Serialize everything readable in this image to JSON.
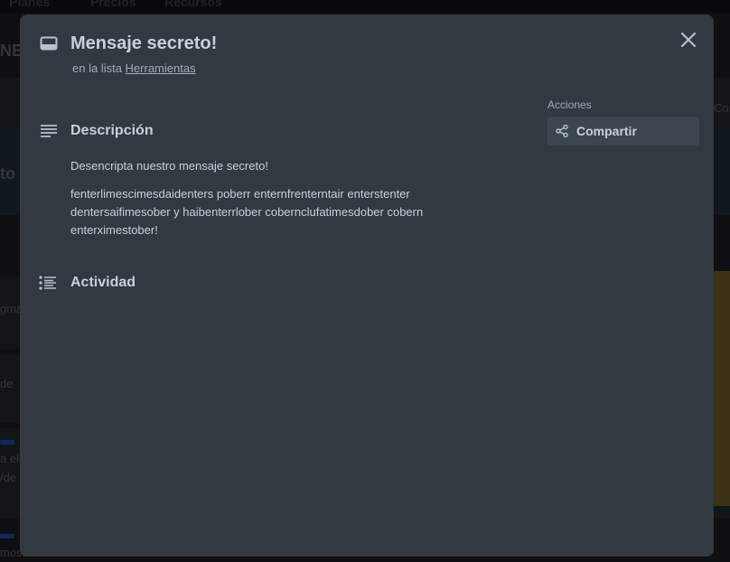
{
  "background": {
    "nav": [
      "Planes",
      "Precios",
      "Recursos"
    ],
    "fragments": [
      "NE",
      "to",
      "Cor",
      "gma",
      "de",
      "a el",
      "/de",
      "mostrar"
    ]
  },
  "card": {
    "title": "Mensaje secreto!",
    "list_prefix": "en la lista",
    "list_name": "Herramientas",
    "close_icon": "close-icon",
    "description": {
      "heading": "Descripción",
      "paragraphs": [
        "Desencripta nuestro mensaje secreto!",
        "fenterlimescimesdaidenters poberr enternfrenterntair enterstenter dentersaifimesober y haibenterrlober cobernclufatimesdober cobern enterximestober!"
      ]
    },
    "activity": {
      "heading": "Actividad"
    },
    "actions": {
      "label": "Acciones",
      "share_label": "Compartir"
    }
  },
  "colors": {
    "modal_bg": "#323940",
    "button_bg": "#3d464f",
    "text": "#c7d1db",
    "muted": "#9fadbc"
  }
}
